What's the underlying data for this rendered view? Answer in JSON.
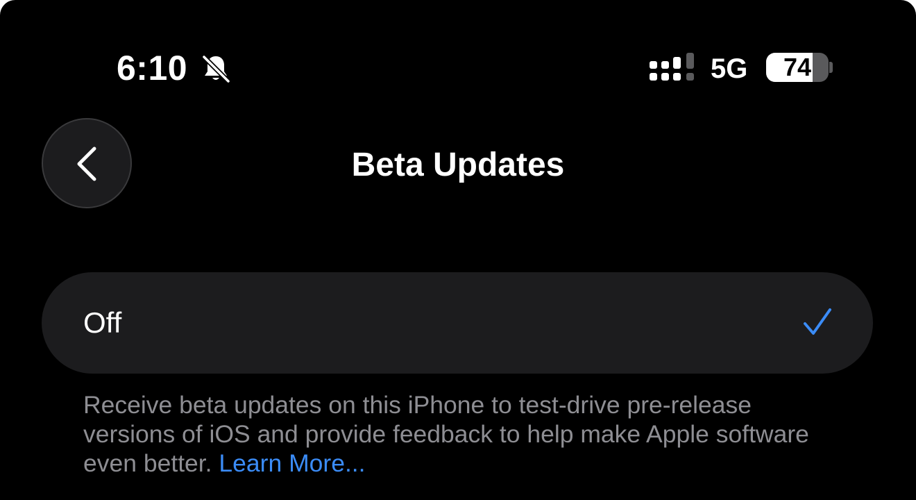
{
  "status_bar": {
    "time": "6:10",
    "network": "5G",
    "battery_percent": "74",
    "battery_level": 0.74,
    "icons": [
      "bell-slash-icon",
      "cellular-signal-icon"
    ]
  },
  "nav": {
    "back_icon": "chevron-left-icon",
    "title": "Beta Updates"
  },
  "options": [
    {
      "label": "Off",
      "selected": true
    }
  ],
  "footer": {
    "description": "Receive beta updates on this iPhone to test-drive pre-release versions of iOS and provide feedback to help make Apple software even better.",
    "link_label": "Learn More..."
  },
  "colors": {
    "background": "#000000",
    "row_background": "#1c1c1e",
    "accent": "#3b8cf7",
    "secondary_text": "#8e8e93"
  }
}
